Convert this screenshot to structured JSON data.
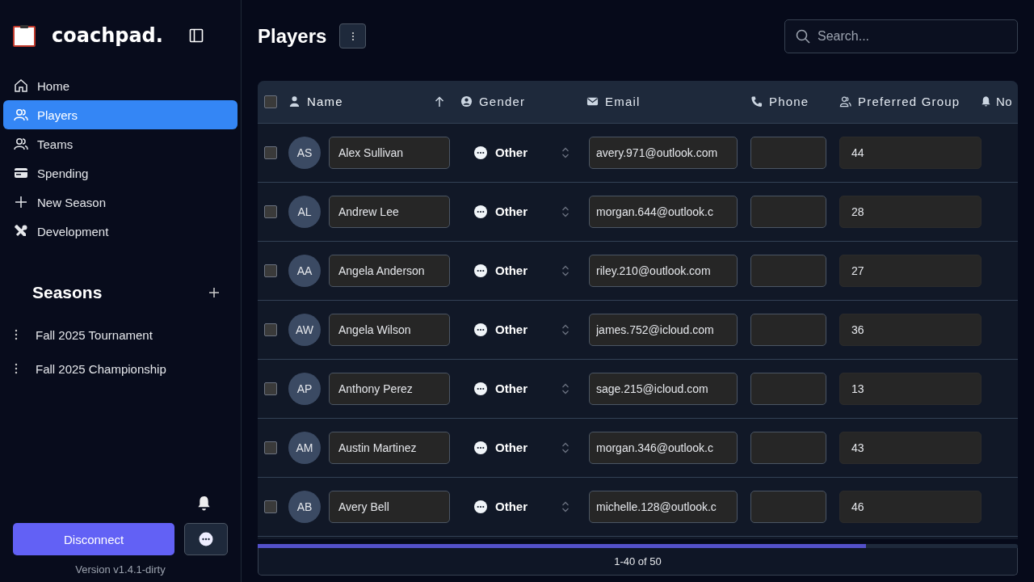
{
  "sidebar": {
    "logo": "coachpad.",
    "nav": [
      {
        "label": "Home",
        "selected": false
      },
      {
        "label": "Players",
        "selected": true
      },
      {
        "label": "Teams",
        "selected": false
      },
      {
        "label": "Spending",
        "selected": false
      },
      {
        "label": "New Season",
        "selected": false
      },
      {
        "label": "Development",
        "selected": false
      }
    ],
    "seasons_title": "Seasons",
    "seasons": [
      "Fall 2025 Tournament",
      "Fall 2025 Championship"
    ],
    "disconnect": "Disconnect",
    "version": "Version v1.4.1-dirty"
  },
  "header": {
    "title": "Players",
    "search": {
      "placeholder": "Search..."
    }
  },
  "table": {
    "select_all": {
      "checked": false
    },
    "columns": [
      {
        "label": "Name",
        "sorted": true
      },
      {
        "label": "Gender",
        "sorted": false
      },
      {
        "label": "Email",
        "sorted": false
      },
      {
        "label": "Phone",
        "sorted": false
      },
      {
        "label": "Preferred Group",
        "sorted": false
      },
      {
        "label": "No",
        "sorted": false
      }
    ],
    "rows": [
      {
        "checked": false,
        "initials": "AS",
        "name": "Alex Sullivan",
        "gender": "Other",
        "email": "avery.971@outlook.com",
        "preferred_group": "44"
      },
      {
        "checked": false,
        "initials": "AL",
        "name": "Andrew Lee",
        "gender": "Other",
        "email": "morgan.644@outlook.c",
        "preferred_group": "28"
      },
      {
        "checked": false,
        "initials": "AA",
        "name": "Angela Anderson",
        "gender": "Other",
        "email": "riley.210@outlook.com",
        "preferred_group": "27"
      },
      {
        "checked": false,
        "initials": "AW",
        "name": "Angela Wilson",
        "gender": "Other",
        "email": "james.752@icloud.com",
        "preferred_group": "36"
      },
      {
        "checked": false,
        "initials": "AP",
        "name": "Anthony Perez",
        "gender": "Other",
        "email": "sage.215@icloud.com",
        "preferred_group": "13"
      },
      {
        "checked": false,
        "initials": "AM",
        "name": "Austin Martinez",
        "gender": "Other",
        "email": "morgan.346@outlook.c",
        "preferred_group": "43"
      },
      {
        "checked": false,
        "initials": "AB",
        "name": "Avery Bell",
        "gender": "Other",
        "email": "michelle.128@outlook.c",
        "preferred_group": "46"
      }
    ]
  },
  "pagination": {
    "level": 0.8,
    "text": "1-40 of 50"
  }
}
